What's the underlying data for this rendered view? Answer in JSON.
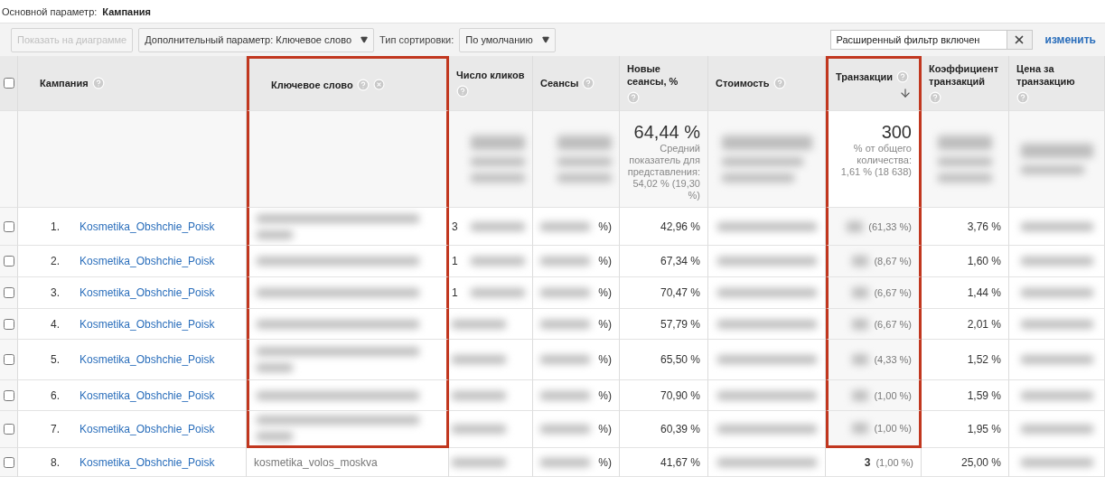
{
  "breadcrumb": {
    "label": "Основной параметр:",
    "value": "Кампания"
  },
  "toolbar": {
    "chart_button": {
      "label": "Показать на диаграмме",
      "disabled": true
    },
    "secondary_dimension": {
      "label": "Дополнительный параметр: Ключевое слово"
    },
    "sort_label": "Тип сортировки:",
    "sort_select": {
      "label": "По умолчанию"
    },
    "filter": {
      "value": "Расширенный фильтр включен"
    },
    "edit_link": "изменить"
  },
  "header_checkbox": {
    "checked": false
  },
  "columns": [
    {
      "label": "Кампания",
      "removable": false,
      "sorted": false,
      "highlighted": false
    },
    {
      "label": "Ключевое слово",
      "removable": true,
      "sorted": false,
      "highlighted": true
    },
    {
      "label": "Число кликов",
      "removable": false,
      "sorted": false,
      "highlighted": false
    },
    {
      "label": "Сеансы",
      "removable": false,
      "sorted": false,
      "highlighted": false
    },
    {
      "label": "Новые сеансы, %",
      "removable": false,
      "sorted": false,
      "highlighted": false
    },
    {
      "label": "Стоимость",
      "removable": false,
      "sorted": false,
      "highlighted": false
    },
    {
      "label": "Транзакции",
      "removable": false,
      "sorted": true,
      "highlighted": true
    },
    {
      "label": "Коэффициент транзакций",
      "removable": false,
      "sorted": false,
      "highlighted": false
    },
    {
      "label": "Цена за транзакцию",
      "removable": false,
      "sorted": false,
      "highlighted": false
    }
  ],
  "summary": {
    "new_sessions": {
      "value": "64,44 %",
      "note": "Средний показатель для представления: 54,02 % (19,30 %)"
    },
    "transactions": {
      "value": "300",
      "note": "% от общего количества: 1,61 % (18 638)"
    }
  },
  "rows": [
    {
      "index": "1.",
      "campaign": "Kosmetika_Obshchie_Poisk",
      "checked": false,
      "keyword": null,
      "clicks_fragment": "3",
      "sessions_fragment": "%)",
      "new_sessions": "42,96 %",
      "transactions": null,
      "transactions_share": "(61,33 %)",
      "conversion": "3,76 %",
      "highlighted": true
    },
    {
      "index": "2.",
      "campaign": "Kosmetika_Obshchie_Poisk",
      "checked": false,
      "keyword": null,
      "clicks_fragment": "1",
      "sessions_fragment": "%)",
      "new_sessions": "67,34 %",
      "transactions": null,
      "transactions_share": "(8,67 %)",
      "conversion": "1,60 %",
      "highlighted": true
    },
    {
      "index": "3.",
      "campaign": "Kosmetika_Obshchie_Poisk",
      "checked": false,
      "keyword": null,
      "clicks_fragment": "1",
      "sessions_fragment": "%)",
      "new_sessions": "70,47 %",
      "transactions": null,
      "transactions_share": "(6,67 %)",
      "conversion": "1,44 %",
      "highlighted": true
    },
    {
      "index": "4.",
      "campaign": "Kosmetika_Obshchie_Poisk",
      "checked": false,
      "keyword": null,
      "clicks_fragment": null,
      "sessions_fragment": "%)",
      "new_sessions": "57,79 %",
      "transactions": null,
      "transactions_share": "(6,67 %)",
      "conversion": "2,01 %",
      "highlighted": true
    },
    {
      "index": "5.",
      "campaign": "Kosmetika_Obshchie_Poisk",
      "checked": false,
      "keyword": null,
      "clicks_fragment": null,
      "sessions_fragment": "%)",
      "new_sessions": "65,50 %",
      "transactions": null,
      "transactions_share": "(4,33 %)",
      "conversion": "1,52 %",
      "highlighted": true
    },
    {
      "index": "6.",
      "campaign": "Kosmetika_Obshchie_Poisk",
      "checked": false,
      "keyword": null,
      "clicks_fragment": null,
      "sessions_fragment": "%)",
      "new_sessions": "70,90 %",
      "transactions": null,
      "transactions_share": "(1,00 %)",
      "conversion": "1,59 %",
      "highlighted": true
    },
    {
      "index": "7.",
      "campaign": "Kosmetika_Obshchie_Poisk",
      "checked": false,
      "keyword": null,
      "clicks_fragment": null,
      "sessions_fragment": "%)",
      "new_sessions": "60,39 %",
      "transactions": null,
      "transactions_share": "(1,00 %)",
      "conversion": "1,95 %",
      "highlighted": true
    },
    {
      "index": "8.",
      "campaign": "Kosmetika_Obshchie_Poisk",
      "checked": false,
      "keyword": "kosmetika_volos_moskva",
      "clicks_fragment": null,
      "sessions_fragment": "%)",
      "new_sessions": "41,67 %",
      "transactions": "3",
      "transactions_share": "(1,00 %)",
      "conversion": "25,00 %",
      "highlighted": false
    }
  ]
}
